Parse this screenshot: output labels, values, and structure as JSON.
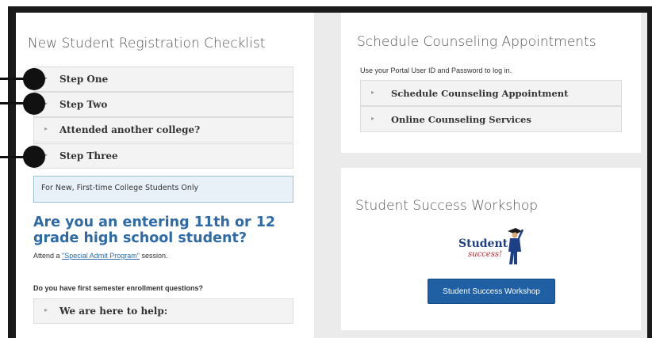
{
  "left": {
    "title": "New Student Registration Checklist",
    "steps": [
      {
        "label": "Step One"
      },
      {
        "label": "Step Two"
      },
      {
        "label": "Attended another college?"
      },
      {
        "label": "Step Three"
      }
    ],
    "notice": "For New, First-time College Students Only",
    "question_heading": "Are you an entering 11th or 12 grade high school student?",
    "attend_prefix": "Attend a ",
    "attend_link": "\"Special Admit Program\"",
    "attend_suffix": " session.",
    "enrollment_question": "Do you have first semester enrollment questions?",
    "help_label": "We are here to help:"
  },
  "counseling": {
    "title": "Schedule Counseling Appointments",
    "login_note": "Use your Portal User ID and Password to log in.",
    "items": [
      {
        "label": "Schedule Counseling Appointment"
      },
      {
        "label": "Online Counseling Services"
      }
    ]
  },
  "workshop": {
    "title": "Student Success Workshop",
    "logo_word1": "Student",
    "logo_word2": "success!",
    "button_label": "Student Success Workshop"
  },
  "colors": {
    "accent_blue": "#2d6aa7",
    "button_blue": "#1f5fa3",
    "callout_black": "#111111"
  },
  "icons": [
    "chevron-right-icon",
    "student-success-logo"
  ]
}
